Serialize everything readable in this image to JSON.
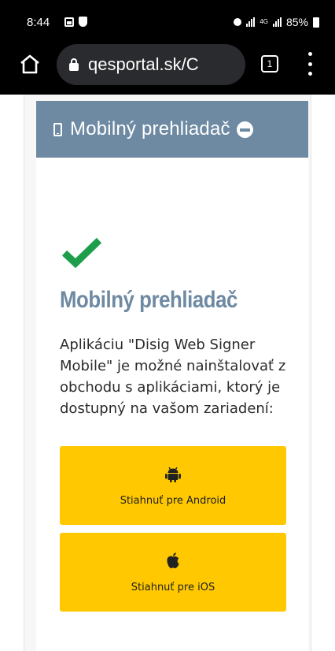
{
  "status_bar": {
    "time": "8:44",
    "network": "4G",
    "battery": "85%",
    "icons": [
      "image-icon",
      "shield-icon",
      "lock-icon",
      "signal-icon",
      "signal-icon",
      "battery-icon"
    ]
  },
  "browser": {
    "url": "qesportal.sk/C",
    "tab_count": "1",
    "icons": [
      "home-icon",
      "lock-icon",
      "tabs-icon",
      "more-vert-icon"
    ]
  },
  "panel": {
    "title": "Mobilný prehliadač",
    "header_color": "#6e8aa3",
    "icons": [
      "mobile-phone-icon",
      "minus-circle-icon"
    ]
  },
  "content": {
    "heading": "Mobilný prehliadač",
    "description": "Aplikáciu \"Disig Web Signer Mobile\" je možné nainštalovať z obchodu s aplikáciami, ktorý je dostupný na vašom zariadení:",
    "status_icon": "checkmark-icon",
    "check_color": "#1e9e4a"
  },
  "downloads": {
    "button_color": "#ffc800",
    "android": {
      "label": "Stiahnuť pre Android",
      "icon": "android-icon"
    },
    "ios": {
      "label": "Stiahnuť pre iOS",
      "icon": "apple-icon"
    }
  }
}
